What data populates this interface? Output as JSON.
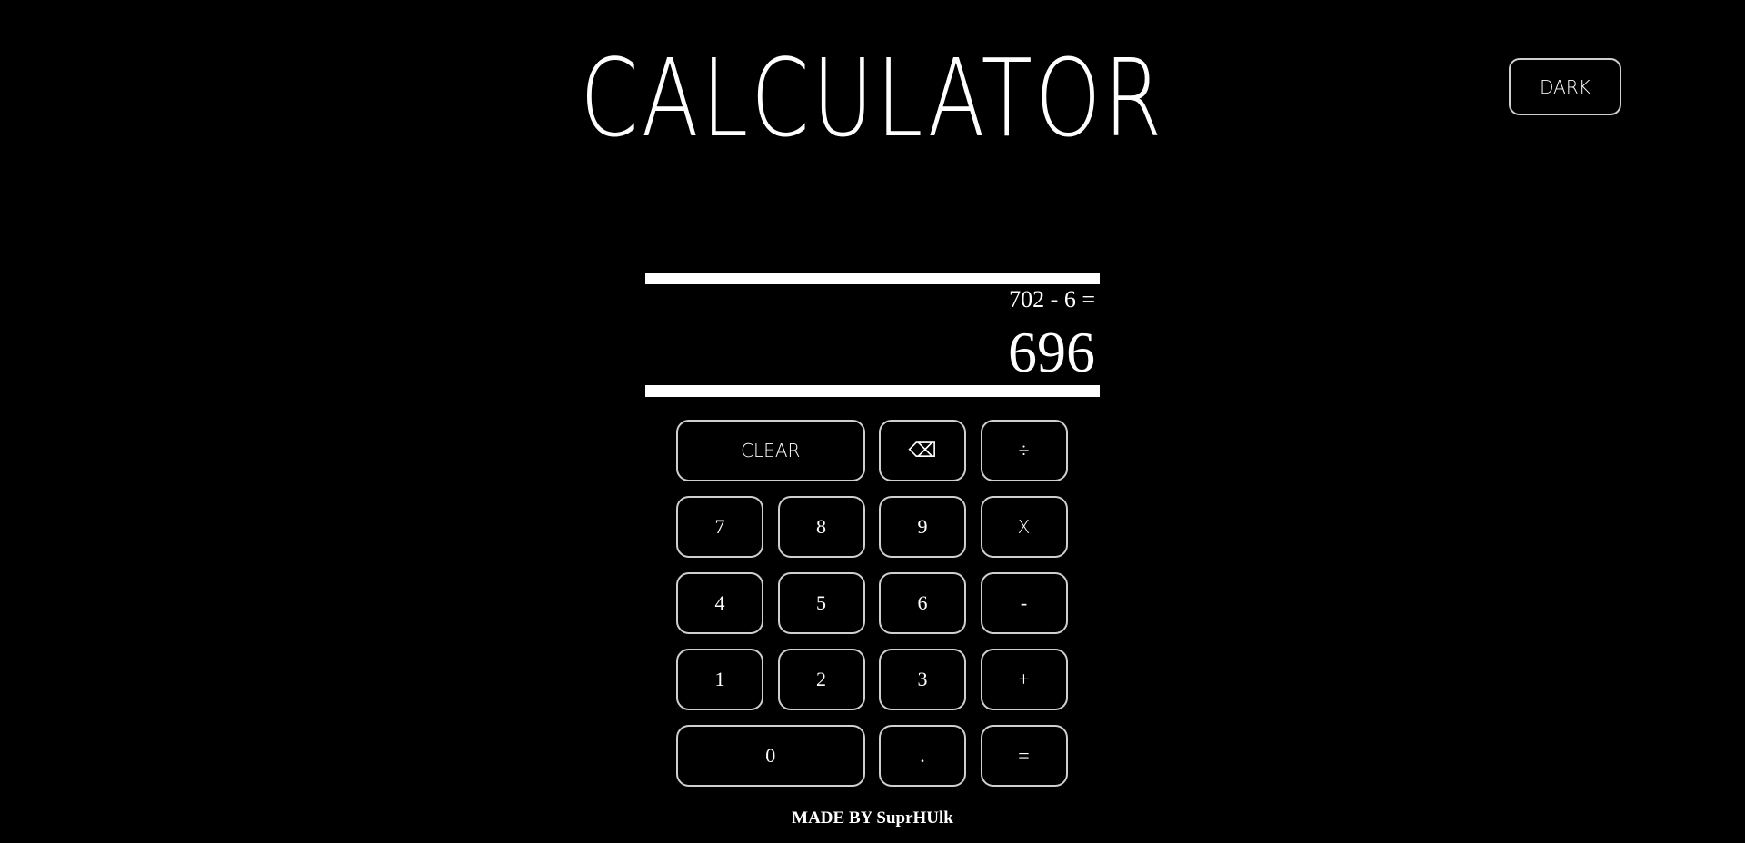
{
  "header": {
    "title": "CALCULATOR",
    "theme_toggle_label": "DARK"
  },
  "display": {
    "previous_operand": "702 - 6 =",
    "current_operand": "696"
  },
  "keypad": {
    "clear": "CLEAR",
    "backspace": "⌫",
    "divide": "÷",
    "seven": "7",
    "eight": "8",
    "nine": "9",
    "multiply": "X",
    "four": "4",
    "five": "5",
    "six": "6",
    "subtract": "-",
    "one": "1",
    "two": "2",
    "three": "3",
    "add": "+",
    "zero": "0",
    "decimal": ".",
    "equals": "="
  },
  "footer": {
    "credit": "MADE BY SuprHUlk"
  },
  "colors": {
    "background": "#000000",
    "foreground": "#ffffff",
    "button_border": "#cfcfcf"
  }
}
